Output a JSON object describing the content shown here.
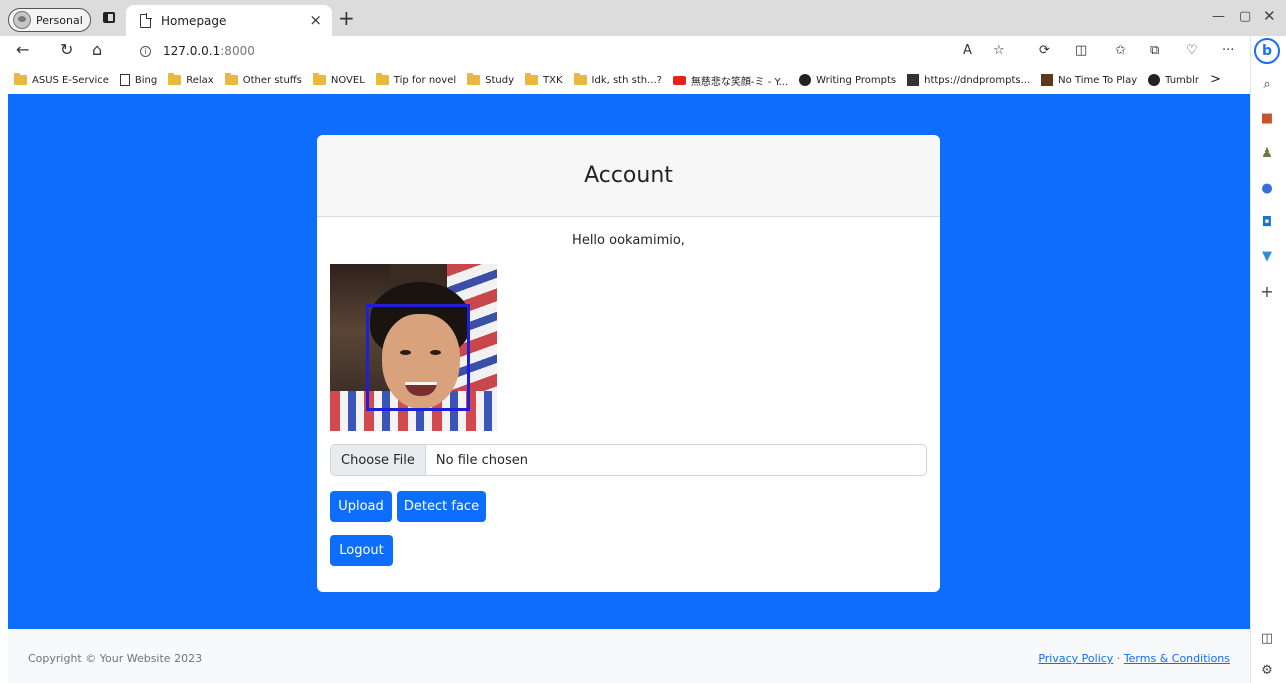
{
  "browser": {
    "profile_label": "Personal",
    "tab_title": "Homepage",
    "tab_close": "×",
    "new_tab": "+",
    "url_host": "127.0.0.1",
    "url_port": ":8000",
    "bookmarks": [
      {
        "label": "ASUS E-Service",
        "icon": "folder-icon"
      },
      {
        "label": "Bing",
        "icon": "page-icon"
      },
      {
        "label": "Relax",
        "icon": "folder-icon"
      },
      {
        "label": "Other stuffs",
        "icon": "folder-icon"
      },
      {
        "label": "NOVEL",
        "icon": "folder-icon"
      },
      {
        "label": "Tip for novel",
        "icon": "folder-icon"
      },
      {
        "label": "Study",
        "icon": "folder-icon"
      },
      {
        "label": "TXK",
        "icon": "folder-icon"
      },
      {
        "label": "Idk, sth sth...?",
        "icon": "folder-icon"
      },
      {
        "label": "無慈悲な笑顔-ミ - Y...",
        "icon": "youtube-icon"
      },
      {
        "label": "Writing Prompts",
        "icon": "compass-icon"
      },
      {
        "label": "https://dndprompts...",
        "icon": "site-icon"
      },
      {
        "label": "No Time To Play",
        "icon": "site-icon"
      },
      {
        "label": "Tumblr",
        "icon": "tumblr-icon"
      }
    ],
    "more_bookmarks": ">"
  },
  "card": {
    "title": "Account",
    "greeting": "Hello ookamimio,",
    "file_button": "Choose File",
    "file_status": "No file chosen",
    "upload_label": "Upload",
    "detect_label": "Detect face",
    "logout_label": "Logout"
  },
  "footer": {
    "copyright": "Copyright © Your Website 2023",
    "privacy": "Privacy Policy",
    "separator": " · ",
    "terms": "Terms & Conditions"
  },
  "colors": {
    "primary": "#0d6efd",
    "face_box": "#1f1fd6",
    "card_header_bg": "#f7f7f7"
  }
}
